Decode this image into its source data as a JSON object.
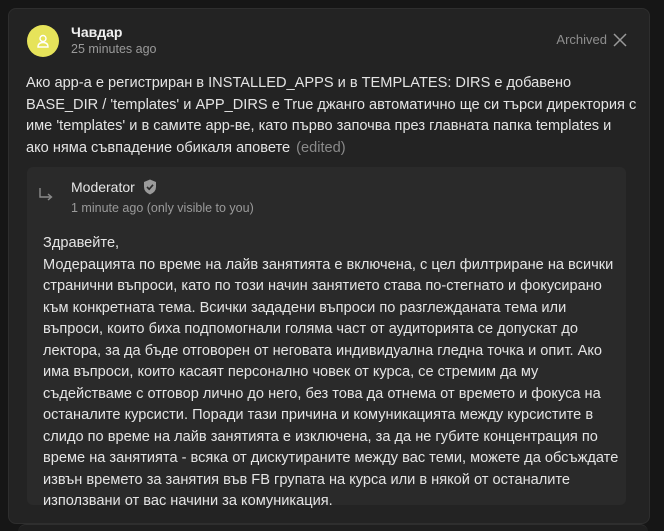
{
  "post": {
    "author": "Чавдар",
    "time": "25 minutes ago",
    "archived_label": "Archived",
    "text": "Ако app-а е регистриран в INSTALLED_APPS и в TEMPLATES: DIRS е добавено BASE_DIR / 'templates' и APP_DIRS е True джанго автоматично ще си търси директория с име 'templates' и в самите app-ве, като първо започва през главната папка templates и ако няма съвпадение обикаля аповете",
    "edited_label": "(edited)"
  },
  "reply": {
    "author": "Moderator",
    "time": "1 minute ago (only visible to you)",
    "greeting": "Здравейте,",
    "text": "Модерацията по време на лайв занятията е включена, с цел филтриране на всички странични въпроси, като по този начин занятието става по-стегнато и фокусирано към конкретната тема. Всички зададени въпроси по разглежданата тема или въпроси, които биха подпомогнали голяма част от аудиторията се допускат до лектора, за да бъде отговорен от неговата индивидуална гледна точка и опит. Ако има въпроси, които касаят персонално човек от курса, се стремим да му съдействаме с отговор лично до него, без това да отнема от времето и фокуса на останалите курсисти. Поради тази причина и комуникацията между курсистите в слидо по време на лайв занятията е изключена, за да не губите концентрация по време на занятията - всяка от дискутираните между вас теми, можете да обсъждате извън времето за занятия във FB групата на курса или в някой от останалите използвани от вас начини за комуникация."
  },
  "icons": {
    "avatar": "user-icon",
    "archive": "close-icon",
    "reply": "reply-arrow-icon",
    "verified": "shield-check-icon"
  },
  "colors": {
    "avatar_bg": "#e6e35a",
    "card_bg": "#232323",
    "reply_bg": "#2a2a2a"
  }
}
